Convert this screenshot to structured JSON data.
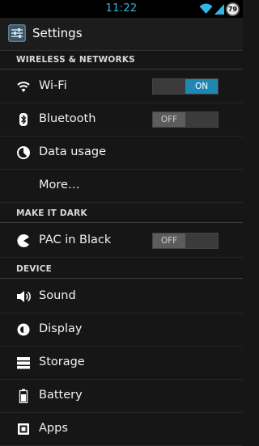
{
  "status_bar": {
    "time": "11:22",
    "battery_level": "79",
    "icons": [
      "wifi-icon",
      "signal-icon",
      "battery-icon"
    ],
    "accent_color": "#33b5e5"
  },
  "action_bar": {
    "title": "Settings",
    "icon": "settings-app-icon"
  },
  "sections": [
    {
      "header": "WIRELESS & NETWORKS",
      "items": [
        {
          "label": "Wi-Fi",
          "icon": "wifi-icon",
          "toggle": "ON"
        },
        {
          "label": "Bluetooth",
          "icon": "bluetooth-icon",
          "toggle": "OFF"
        },
        {
          "label": "Data usage",
          "icon": "data-usage-icon"
        },
        {
          "label": "More…"
        }
      ]
    },
    {
      "header": "MAKE IT DARK",
      "items": [
        {
          "label": "PAC in Black",
          "icon": "pacman-icon",
          "toggle": "OFF"
        }
      ]
    },
    {
      "header": "DEVICE",
      "items": [
        {
          "label": "Sound",
          "icon": "speaker-icon"
        },
        {
          "label": "Display",
          "icon": "brightness-icon"
        },
        {
          "label": "Storage",
          "icon": "storage-icon"
        },
        {
          "label": "Battery",
          "icon": "battery-icon"
        },
        {
          "label": "Apps",
          "icon": "apps-icon"
        }
      ]
    }
  ],
  "colors": {
    "toggle_on": "#1e87b4",
    "toggle_off": "#5c5c5c",
    "background": "#161616"
  }
}
